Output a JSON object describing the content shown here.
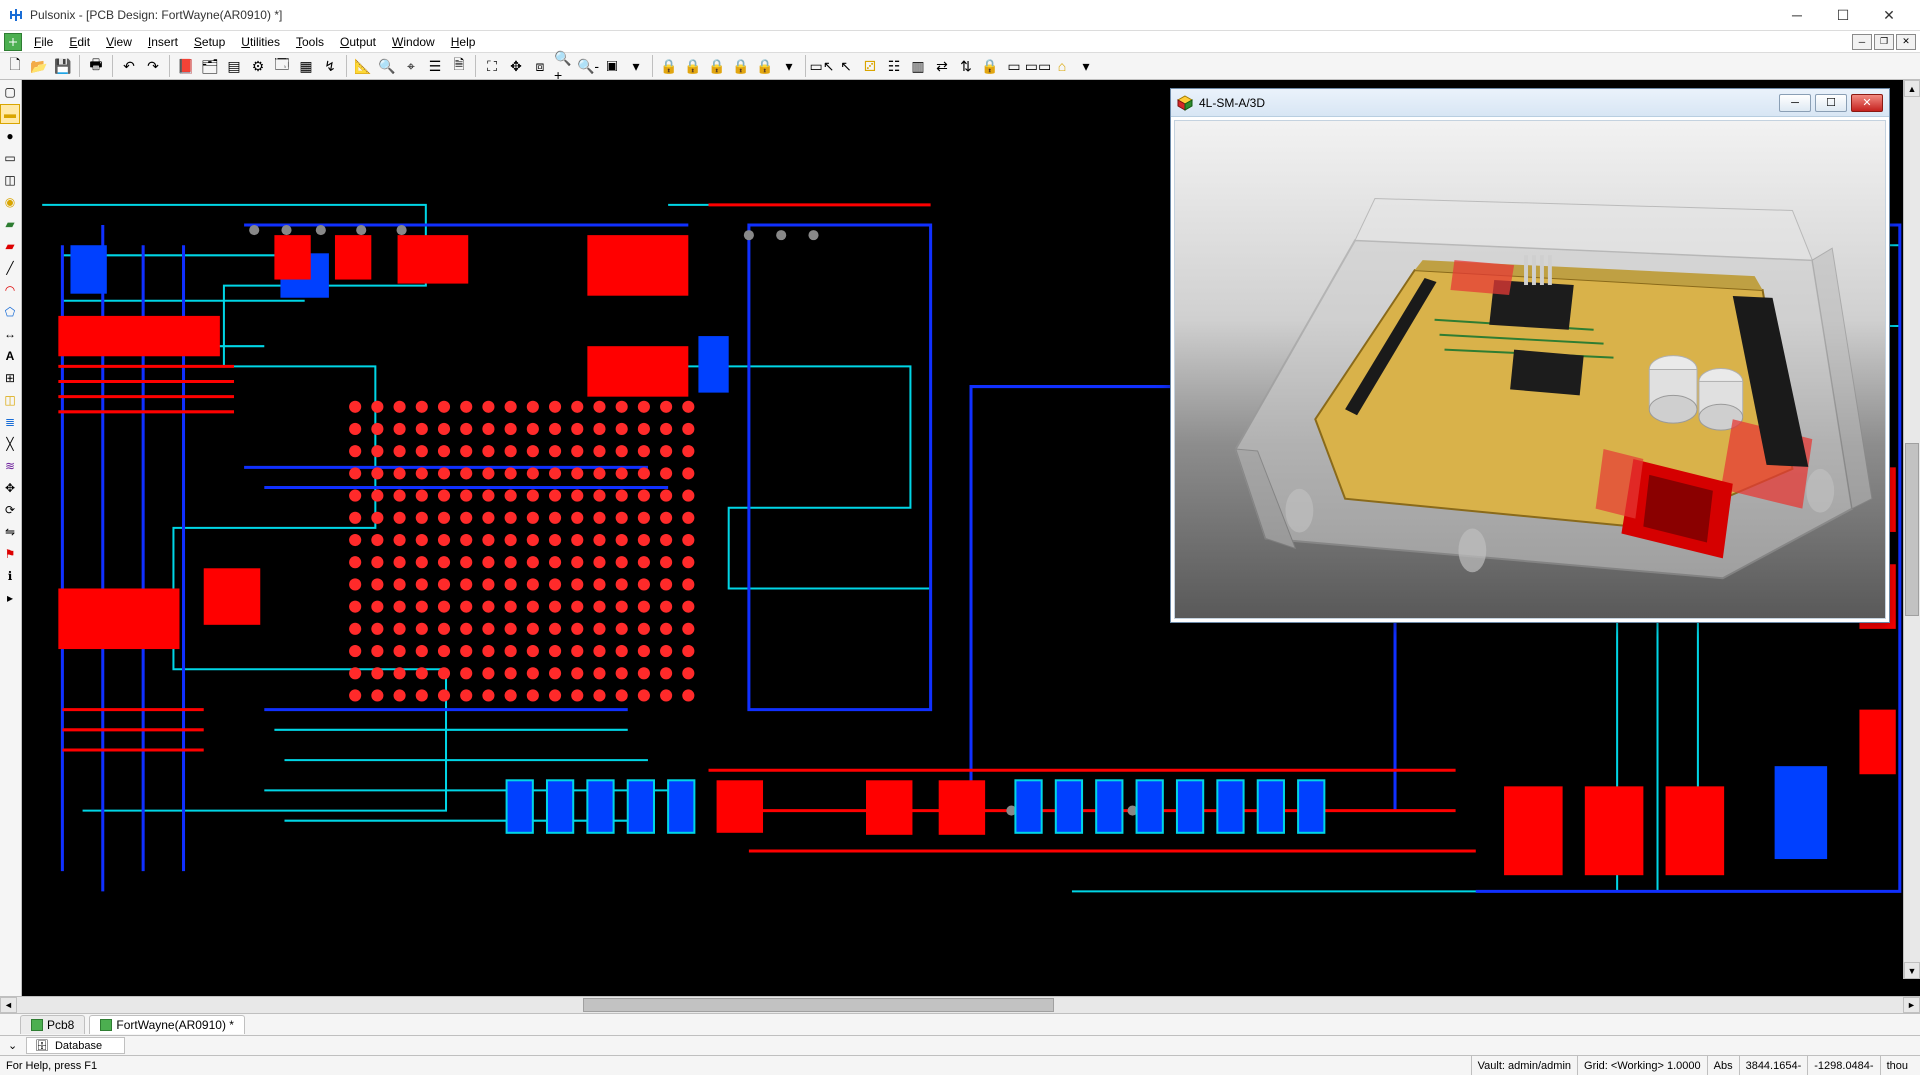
{
  "app_title": "Pulsonix - [PCB Design: FortWayne(AR0910) *]",
  "menu": {
    "file": "File",
    "edit": "Edit",
    "view": "View",
    "insert": "Insert",
    "setup": "Setup",
    "utilities": "Utilities",
    "tools": "Tools",
    "output": "Output",
    "window": "Window",
    "help": "Help"
  },
  "float_window": {
    "title": "4L-SM-A/3D"
  },
  "tabs": [
    {
      "label": "Pcb8"
    },
    {
      "label": "FortWayne(AR0910) *"
    }
  ],
  "database_label": "Database",
  "status": {
    "help": "For Help, press F1",
    "vault": "Vault: admin/admin",
    "grid": "Grid: <Working> 1.0000",
    "abs": "Abs",
    "x": "3844.1654-",
    "y": "-1298.0484-",
    "unit": "thou"
  }
}
